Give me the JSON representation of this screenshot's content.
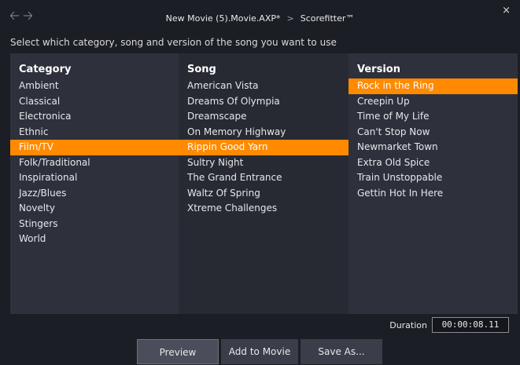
{
  "titlebar": {
    "back_icon": "back-arrow-icon",
    "forward_icon": "forward-arrow-icon",
    "crumbs": [
      "New Movie (5).Movie.AXP*",
      "Scorefitter™"
    ],
    "separator": ">",
    "close": "×"
  },
  "instruction": "Select which category, song and version of the song you want to use",
  "columns": {
    "category": {
      "header": "Category",
      "items": [
        "Ambient",
        "Classical",
        "Electronica",
        "Ethnic",
        "Film/TV",
        "Folk/Traditional",
        "Inspirational",
        "Jazz/Blues",
        "Novelty",
        "Stingers",
        "World"
      ],
      "selected": "Film/TV"
    },
    "song": {
      "header": "Song",
      "items": [
        "American Vista",
        "Dreams Of Olympia",
        "Dreamscape",
        "On Memory Highway",
        "Rippin Good Yarn",
        "Sultry Night",
        "The Grand Entrance",
        "Waltz Of Spring",
        "Xtreme Challenges"
      ],
      "selected": "Rippin Good Yarn"
    },
    "version": {
      "header": "Version",
      "items": [
        "Rock in the Ring",
        "Creepin Up",
        "Time of My Life",
        "Can't Stop Now",
        "Newmarket Town",
        "Extra Old Spice",
        "Train Unstoppable",
        "Gettin Hot In Here"
      ],
      "selected": "Rock in the Ring"
    }
  },
  "duration": {
    "label": "Duration",
    "value": "00:00:08.11"
  },
  "buttons": {
    "preview": "Preview",
    "add": "Add to Movie",
    "save": "Save As..."
  },
  "colors": {
    "accent": "#ff8a00",
    "background": "#1c1e25",
    "panel": "#2e313c",
    "panel_alt": "#282a33"
  }
}
